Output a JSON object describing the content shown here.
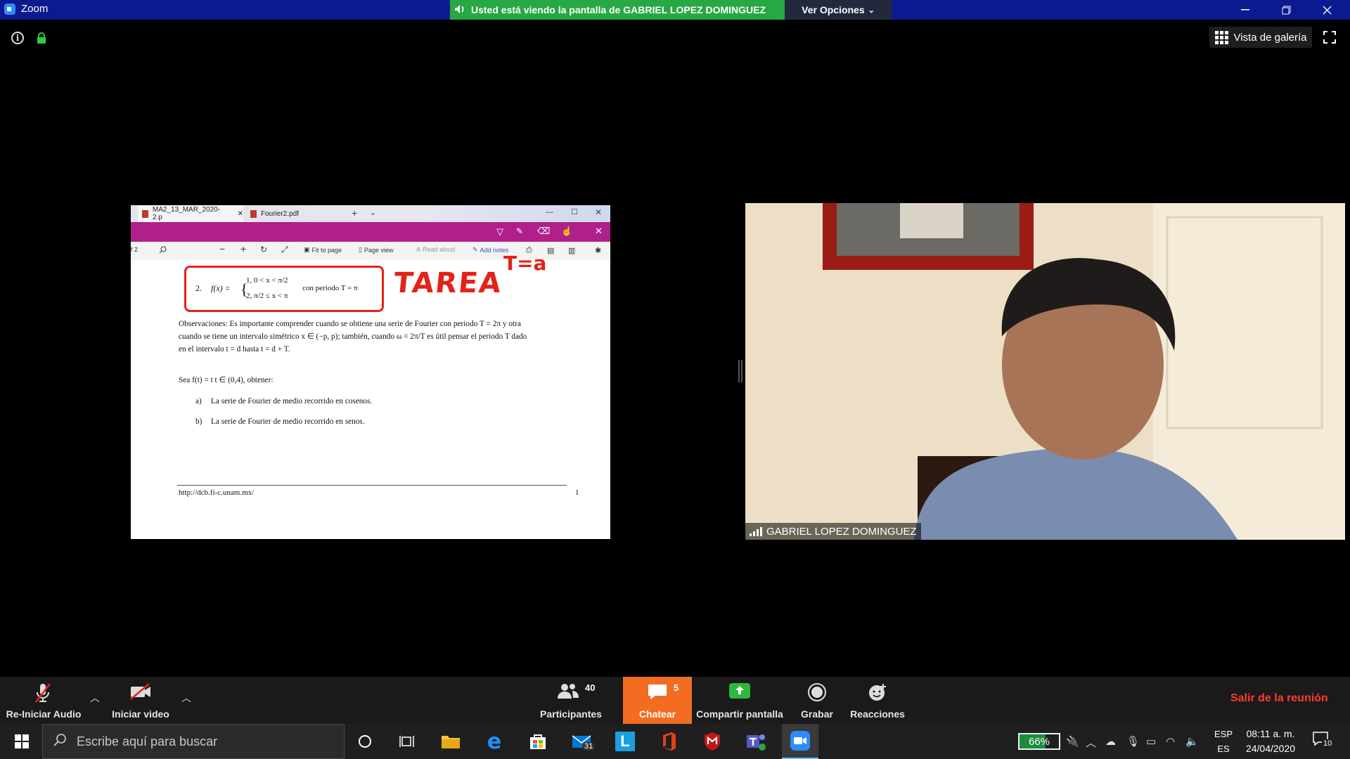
{
  "titlebar": {
    "app_title": "Zoom",
    "share_banner": "Usted está viendo la pantalla de GABRIEL LOPEZ DOMINGUEZ",
    "view_options": "Ver Opciones",
    "gallery_view": "Vista de galería"
  },
  "shared_screen": {
    "tabs": [
      "MA2_13_MAR_2020-2.p",
      "Fourier2.pdf"
    ],
    "toolbar": {
      "page_indicator": "f 2",
      "fit_to_page": "Fit to page",
      "page_view": "Page view",
      "read_aloud": "Read aloud",
      "add_notes": "Add notes"
    },
    "page": {
      "problem_number": "2.",
      "problem_case1": "1,   0 < x < π/2",
      "problem_case2": "2,   π/2 ≤ x < π",
      "problem_func": "f(x) =",
      "problem_period": "con periodo T = π",
      "handwriting_main": "TAREA",
      "handwriting_top": "T=a",
      "observations_1": "Observaciones: Es importante comprender cuando se obtiene una serie de Fourier con periodo T = 2π y otra",
      "observations_2": "cuando se tiene un intervalo simétrico x ∈ (−p, p); también, cuando ω = 2π/T es útil pensar el periodo T dado",
      "observations_3": "en el intervalo t = d hasta t = d + T.",
      "sea": "Sea f(t) = t    t ∈ (0,4), obtener:",
      "item_a_label": "a)",
      "item_a": "La serie de Fourier de medio recorrido en cosenos.",
      "item_b_label": "b)",
      "item_b": "La serie de Fourier de medio recorrido en senos.",
      "footer_url": "http://dcb.fi-c.unam.mx/",
      "page_number": "1"
    }
  },
  "video": {
    "participant_name": "GABRIEL LOPEZ DOMINGUEZ"
  },
  "zoom_toolbar": {
    "audio": "Re-Iniciar Audio",
    "video": "Iniciar video",
    "participants": "Participantes",
    "participants_count": "40",
    "chat": "Chatear",
    "chat_count": "5",
    "share": "Compartir pantalla",
    "record": "Grabar",
    "reactions": "Reacciones",
    "leave": "Salir de la reunión",
    "chat_color": "#f26d21",
    "share_color": "#2db83d"
  },
  "taskbar": {
    "search_placeholder": "Escribe aquí para buscar",
    "mail_badge": "31",
    "battery": "66%",
    "language_top": "ESP",
    "language_bottom": "ES",
    "time": "08:11 a. m.",
    "date": "24/04/2020",
    "notifications": "10"
  }
}
